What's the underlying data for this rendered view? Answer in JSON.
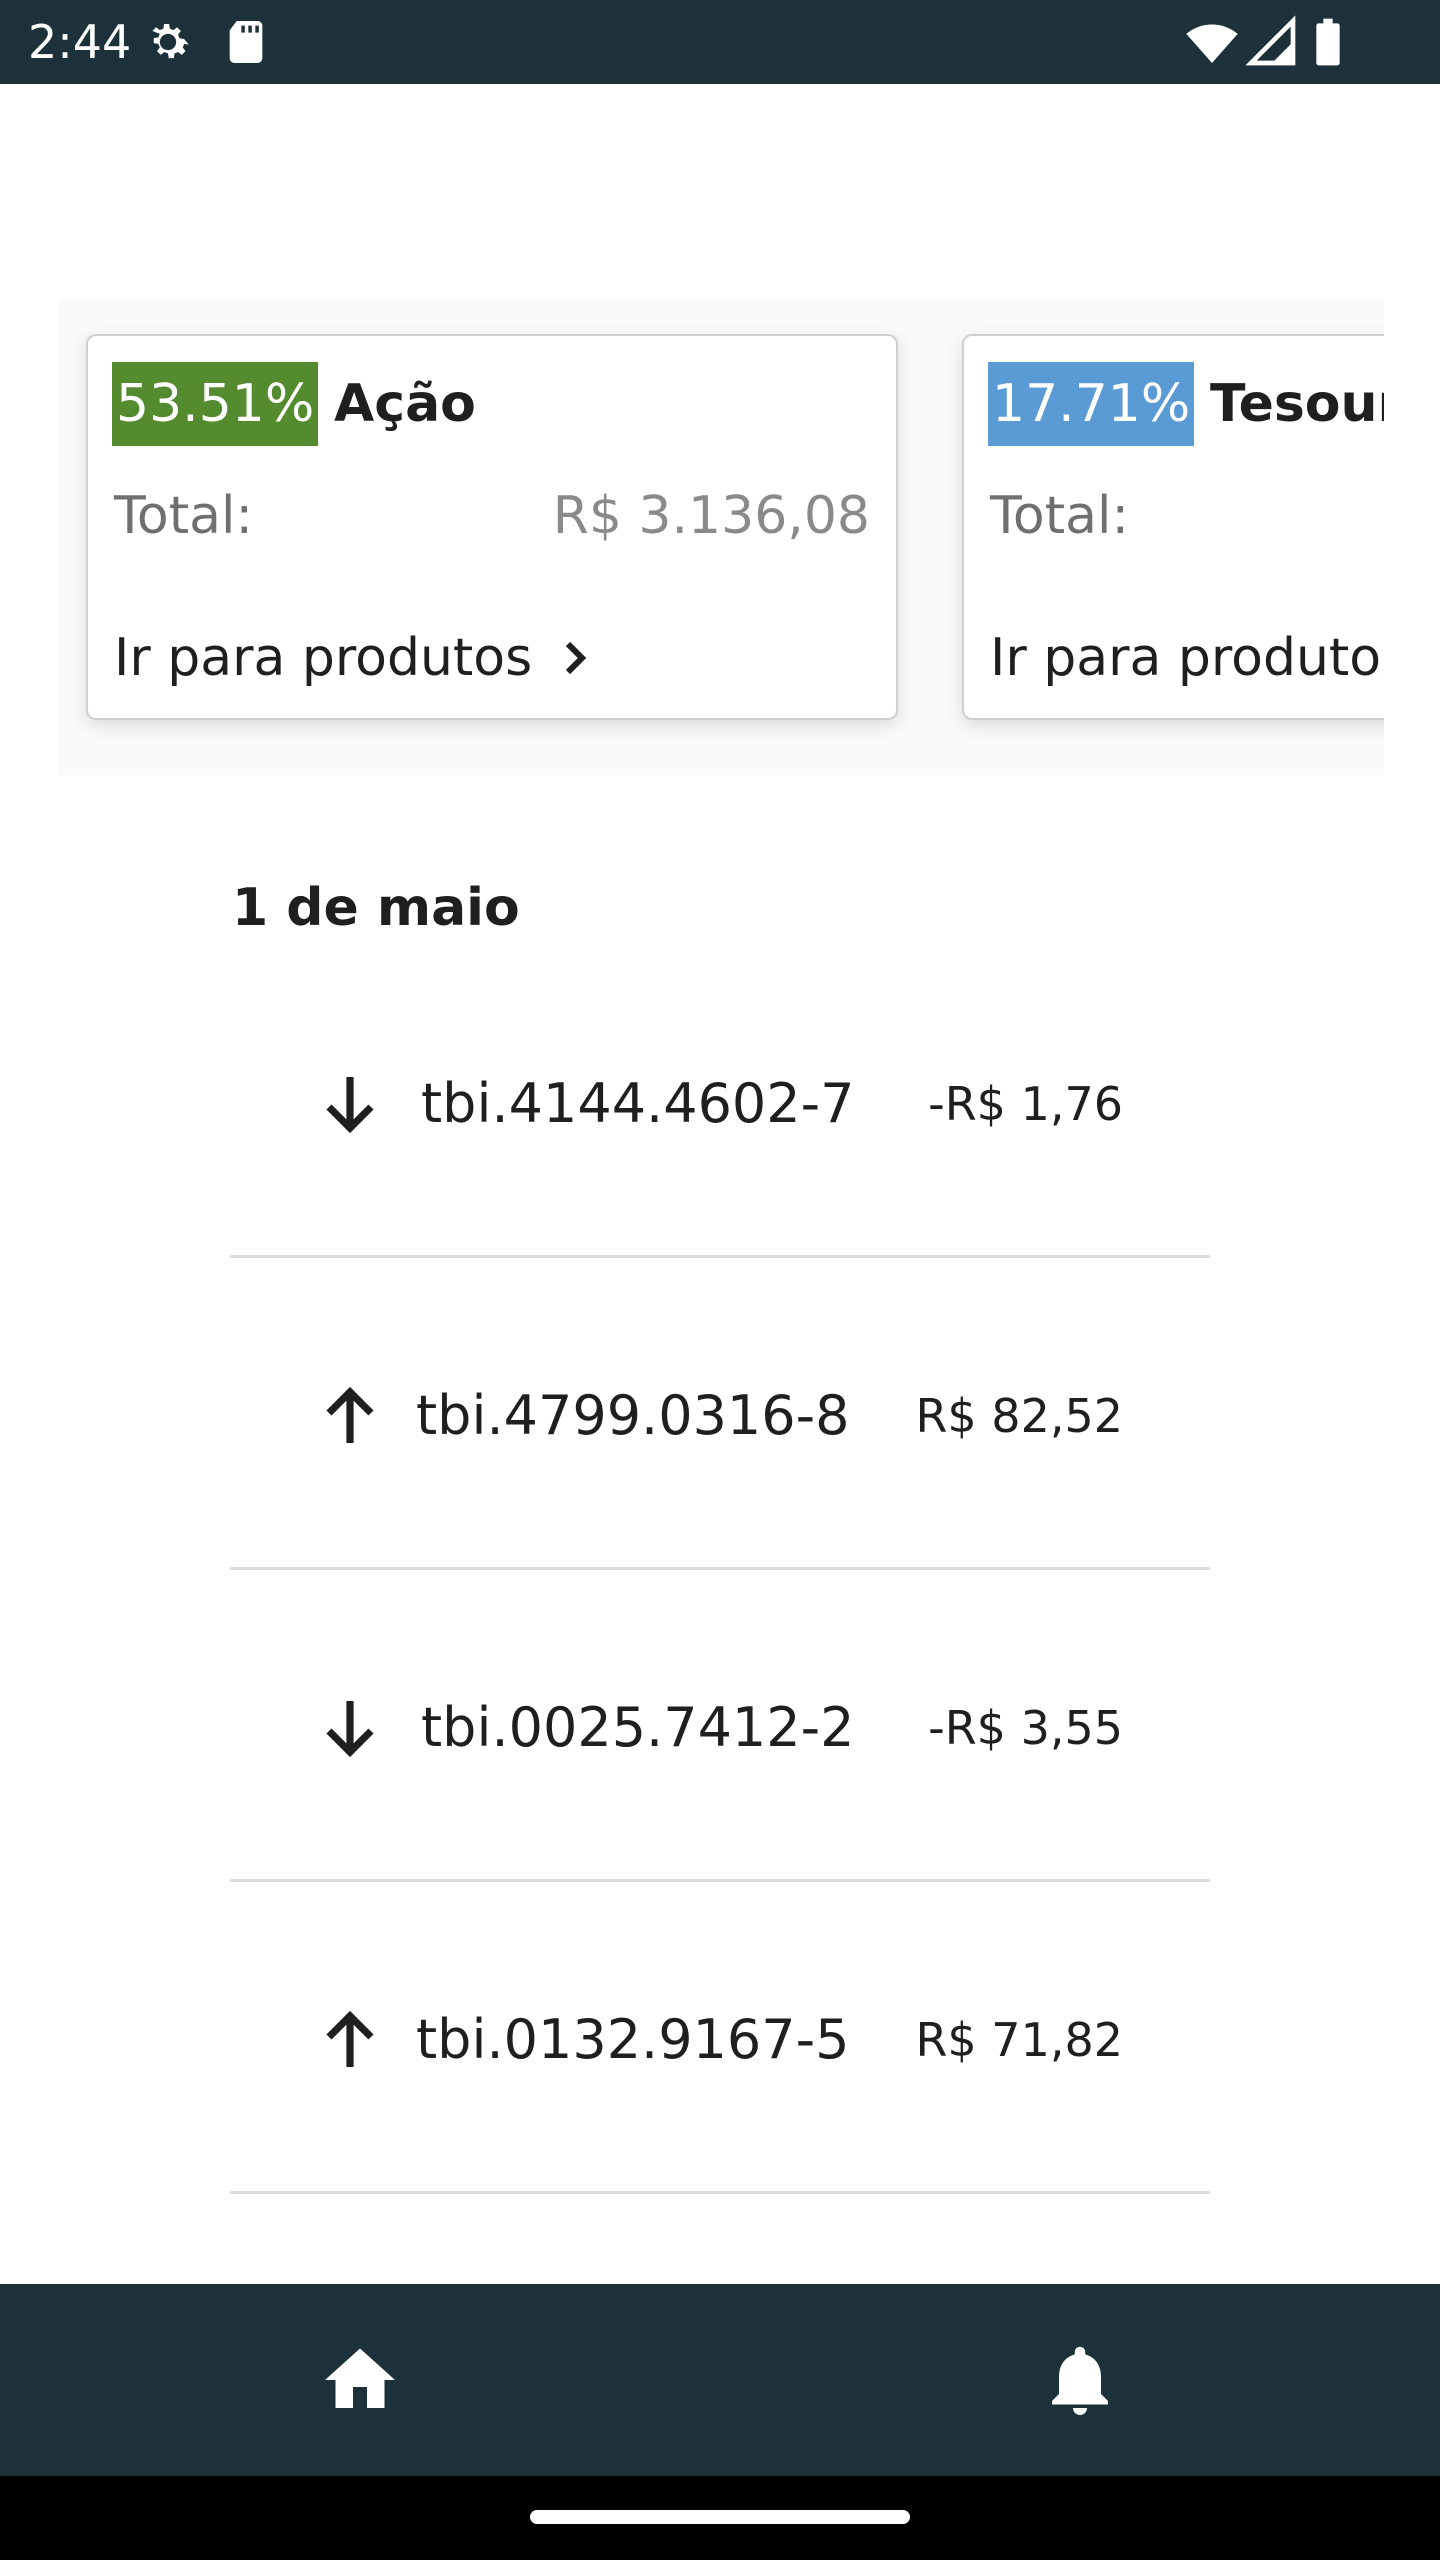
{
  "status_bar": {
    "time": "2:44",
    "icons": [
      "settings-icon",
      "sd-card-icon",
      "wifi-icon",
      "signal-icon",
      "battery-icon"
    ]
  },
  "summary_cards": [
    {
      "percent": "53.51%",
      "percent_color": "#558b2f",
      "name": "Ação",
      "total_label": "Total:",
      "total_value": "R$ 3.136,08",
      "link_label": "Ir para produtos"
    },
    {
      "percent": "17.71%",
      "percent_color": "#5b9bd5",
      "name": "Tesour",
      "total_label": "Total:",
      "link_label": "Ir para produtos"
    }
  ],
  "date_header": "1 de maio",
  "transactions": [
    {
      "direction": "down",
      "icon": "arrow-down-icon",
      "id": "tbi.4144.4602-7",
      "amount": "-R$ 1,76"
    },
    {
      "direction": "up",
      "icon": "arrow-up-icon",
      "id": "tbi.4799.0316-8",
      "amount": "R$ 82,52"
    },
    {
      "direction": "down",
      "icon": "arrow-down-icon",
      "id": "tbi.0025.7412-2",
      "amount": "-R$ 3,55"
    },
    {
      "direction": "up",
      "icon": "arrow-up-icon",
      "id": "tbi.0132.9167-5",
      "amount": "R$ 71,82"
    }
  ],
  "bottom_nav": {
    "items": [
      {
        "icon": "home-icon"
      },
      {
        "icon": "bell-icon"
      }
    ]
  },
  "colors": {
    "bar": "#1c3139",
    "divider": "#dddddd"
  }
}
